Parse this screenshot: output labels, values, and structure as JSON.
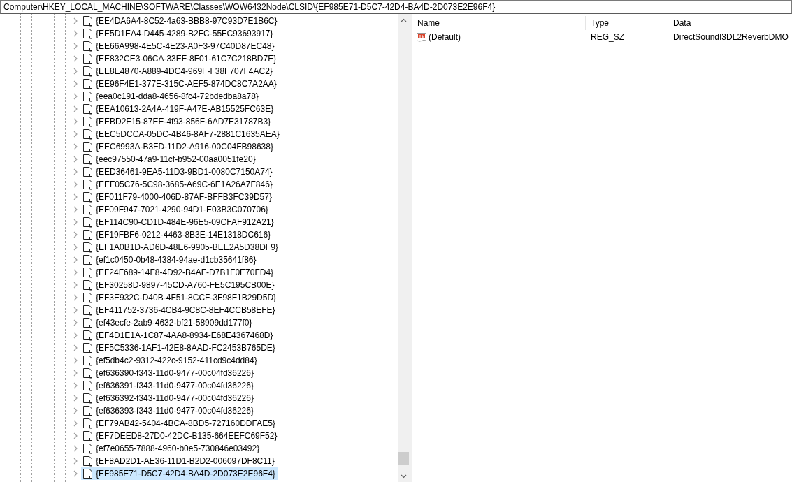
{
  "address_bar": {
    "value": "Computer\\HKEY_LOCAL_MACHINE\\SOFTWARE\\Classes\\WOW6432Node\\CLSID\\{EF985E71-D5C7-42D4-BA4D-2D073E2E96F4}"
  },
  "tree": {
    "items": [
      {
        "label": "{EE4DA6A4-8C52-4a63-BBB8-97C93D7E1B6C}",
        "selected": false
      },
      {
        "label": "{EE5D1EA4-D445-4289-B2FC-55FC93693917}",
        "selected": false
      },
      {
        "label": "{EE66A998-4E5C-4E23-A0F3-97C40D87EC48}",
        "selected": false
      },
      {
        "label": "{EE832CE3-06CA-33EF-8F01-61C7C218BD7E}",
        "selected": false
      },
      {
        "label": "{EE8E4870-A889-4DC4-969F-F38F707F4AC2}",
        "selected": false
      },
      {
        "label": "{EE96F4E1-377E-315C-AEF5-874DC8C7A2AA}",
        "selected": false
      },
      {
        "label": "{eea0c191-dda8-4656-8fc4-72bdedba8a78}",
        "selected": false
      },
      {
        "label": "{EEA10613-2A4A-419F-A47E-AB15525FC63E}",
        "selected": false
      },
      {
        "label": "{EEBD2F15-87EE-4f93-856F-6AD7E31787B3}",
        "selected": false
      },
      {
        "label": "{EEC5DCCA-05DC-4B46-8AF7-2881C1635AEA}",
        "selected": false
      },
      {
        "label": "{EEC6993A-B3FD-11D2-A916-00C04FB98638}",
        "selected": false
      },
      {
        "label": "{eec97550-47a9-11cf-b952-00aa0051fe20}",
        "selected": false
      },
      {
        "label": "{EED36461-9EA5-11D3-9BD1-0080C7150A74}",
        "selected": false
      },
      {
        "label": "{EEF05C76-5C98-3685-A69C-6E1A26A7F846}",
        "selected": false
      },
      {
        "label": "{EF011F79-4000-406D-87AF-BFFB3FC39D57}",
        "selected": false
      },
      {
        "label": "{EF09F947-7021-4290-94D1-E03B3C070706}",
        "selected": false
      },
      {
        "label": "{EF114C90-CD1D-484E-96E5-09CFAF912A21}",
        "selected": false
      },
      {
        "label": "{EF19FBF6-0212-4463-8B3E-14E1318DC616}",
        "selected": false
      },
      {
        "label": "{EF1A0B1D-AD6D-48E6-9905-BEE2A5D38DF9}",
        "selected": false
      },
      {
        "label": "{ef1c0450-0b48-4384-94ae-d1cb35641f86}",
        "selected": false
      },
      {
        "label": "{EF24F689-14F8-4D92-B4AF-D7B1F0E70FD4}",
        "selected": false
      },
      {
        "label": "{EF30258D-9897-45CD-A760-FE5C195CB00E}",
        "selected": false
      },
      {
        "label": "{EF3E932C-D40B-4F51-8CCF-3F98F1B29D5D}",
        "selected": false
      },
      {
        "label": "{EF411752-3736-4CB4-9C8C-8EF4CCB58EFE}",
        "selected": false
      },
      {
        "label": "{ef43ecfe-2ab9-4632-bf21-58909dd177f0}",
        "selected": false
      },
      {
        "label": "{EF4D1E1A-1C87-4AA8-8934-E68E4367468D}",
        "selected": false
      },
      {
        "label": "{EF5C5336-1AF1-42E8-8AAD-FC2453B765DE}",
        "selected": false
      },
      {
        "label": "{ef5db4c2-9312-422c-9152-411cd9c4dd84}",
        "selected": false
      },
      {
        "label": "{ef636390-f343-11d0-9477-00c04fd36226}",
        "selected": false
      },
      {
        "label": "{ef636391-f343-11d0-9477-00c04fd36226}",
        "selected": false
      },
      {
        "label": "{ef636392-f343-11d0-9477-00c04fd36226}",
        "selected": false
      },
      {
        "label": "{ef636393-f343-11d0-9477-00c04fd36226}",
        "selected": false
      },
      {
        "label": "{EF79AB42-5404-4BCA-8BD5-727160DDFAE5}",
        "selected": false
      },
      {
        "label": "{EF7DEED8-27D0-42DC-B135-664EEFC69F52}",
        "selected": false
      },
      {
        "label": "{ef7e0655-7888-4960-b0e5-730846e03492}",
        "selected": false
      },
      {
        "label": "{EF8AD2D1-AE36-11D1-B2D2-006097DF8C11}",
        "selected": false
      },
      {
        "label": "{EF985E71-D5C7-42D4-BA4D-2D073E2E96F4}",
        "selected": true
      }
    ]
  },
  "values": {
    "columns": [
      "Name",
      "Type",
      "Data"
    ],
    "rows": [
      {
        "name": "(Default)",
        "type": "REG_SZ",
        "data": "DirectSoundI3DL2ReverbDMO",
        "selected": false
      }
    ]
  }
}
